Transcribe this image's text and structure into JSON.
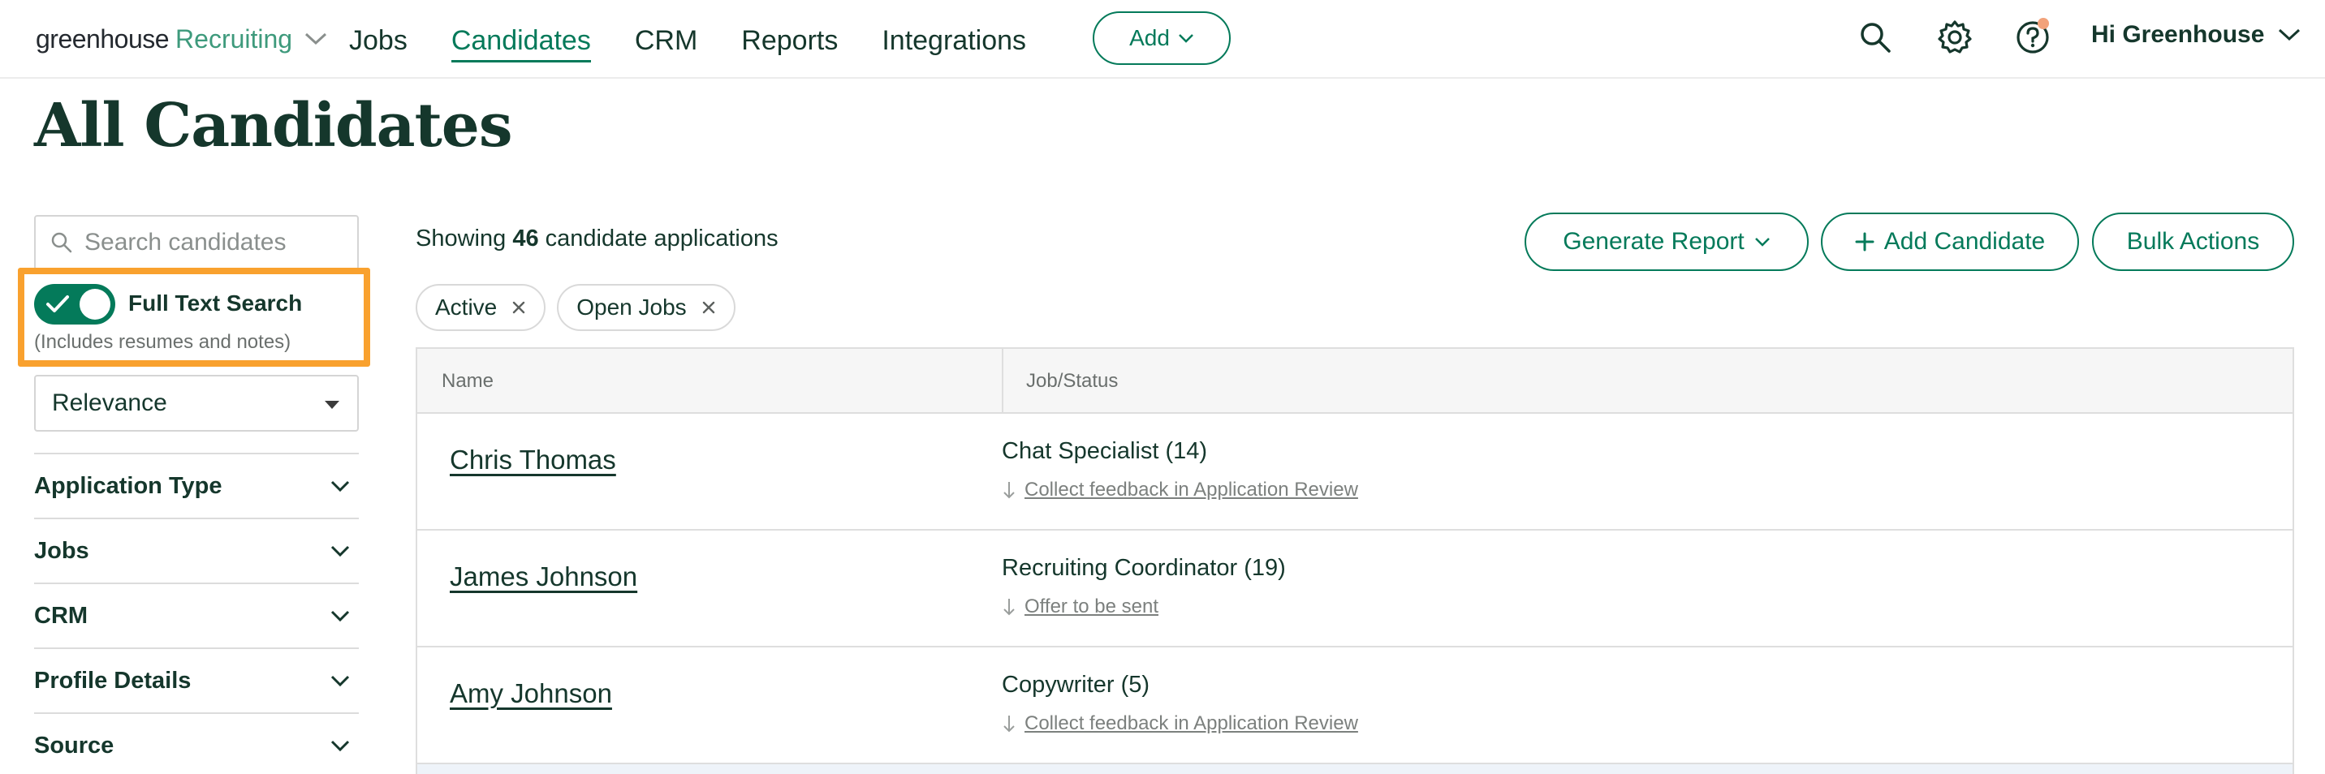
{
  "nav": {
    "logo_brand": "greenhouse",
    "logo_product": "Recruiting",
    "links": [
      "Jobs",
      "Candidates",
      "CRM",
      "Reports",
      "Integrations"
    ],
    "active_link": "Candidates",
    "add_label": "Add",
    "user_label": "Hi Greenhouse",
    "icons": [
      "search-icon",
      "gear-icon",
      "help-icon"
    ]
  },
  "page": {
    "title": "All Candidates"
  },
  "sidebar": {
    "search_placeholder": "Search candidates",
    "full_text_search": {
      "label": "Full Text Search",
      "sublabel": "(Includes resumes and notes)",
      "enabled": true
    },
    "sort_value": "Relevance",
    "filters": [
      "Application Type",
      "Jobs",
      "CRM",
      "Profile Details",
      "Source"
    ]
  },
  "main": {
    "showing_prefix": "Showing",
    "showing_count": "46",
    "showing_suffix": "candidate applications",
    "buttons": {
      "generate_report": "Generate Report",
      "add_candidate": "Add Candidate",
      "bulk_actions": "Bulk Actions"
    },
    "chips": [
      "Active",
      "Open Jobs"
    ],
    "table": {
      "columns": [
        "Name",
        "Job/Status"
      ],
      "rows": [
        {
          "name": "Chris Thomas",
          "job": "Chat Specialist (14)",
          "status": "Collect feedback in Application Review"
        },
        {
          "name": "James Johnson",
          "job": "Recruiting Coordinator (19)",
          "status": "Offer to be sent"
        },
        {
          "name": "Amy Johnson",
          "job": "Copywriter (5)",
          "status": "Collect feedback in Application Review"
        }
      ]
    }
  },
  "colors": {
    "brand_green": "#047a5a",
    "highlight_orange": "#f9a12e",
    "text_dark": "#15372c",
    "notification": "#f2a27a"
  }
}
